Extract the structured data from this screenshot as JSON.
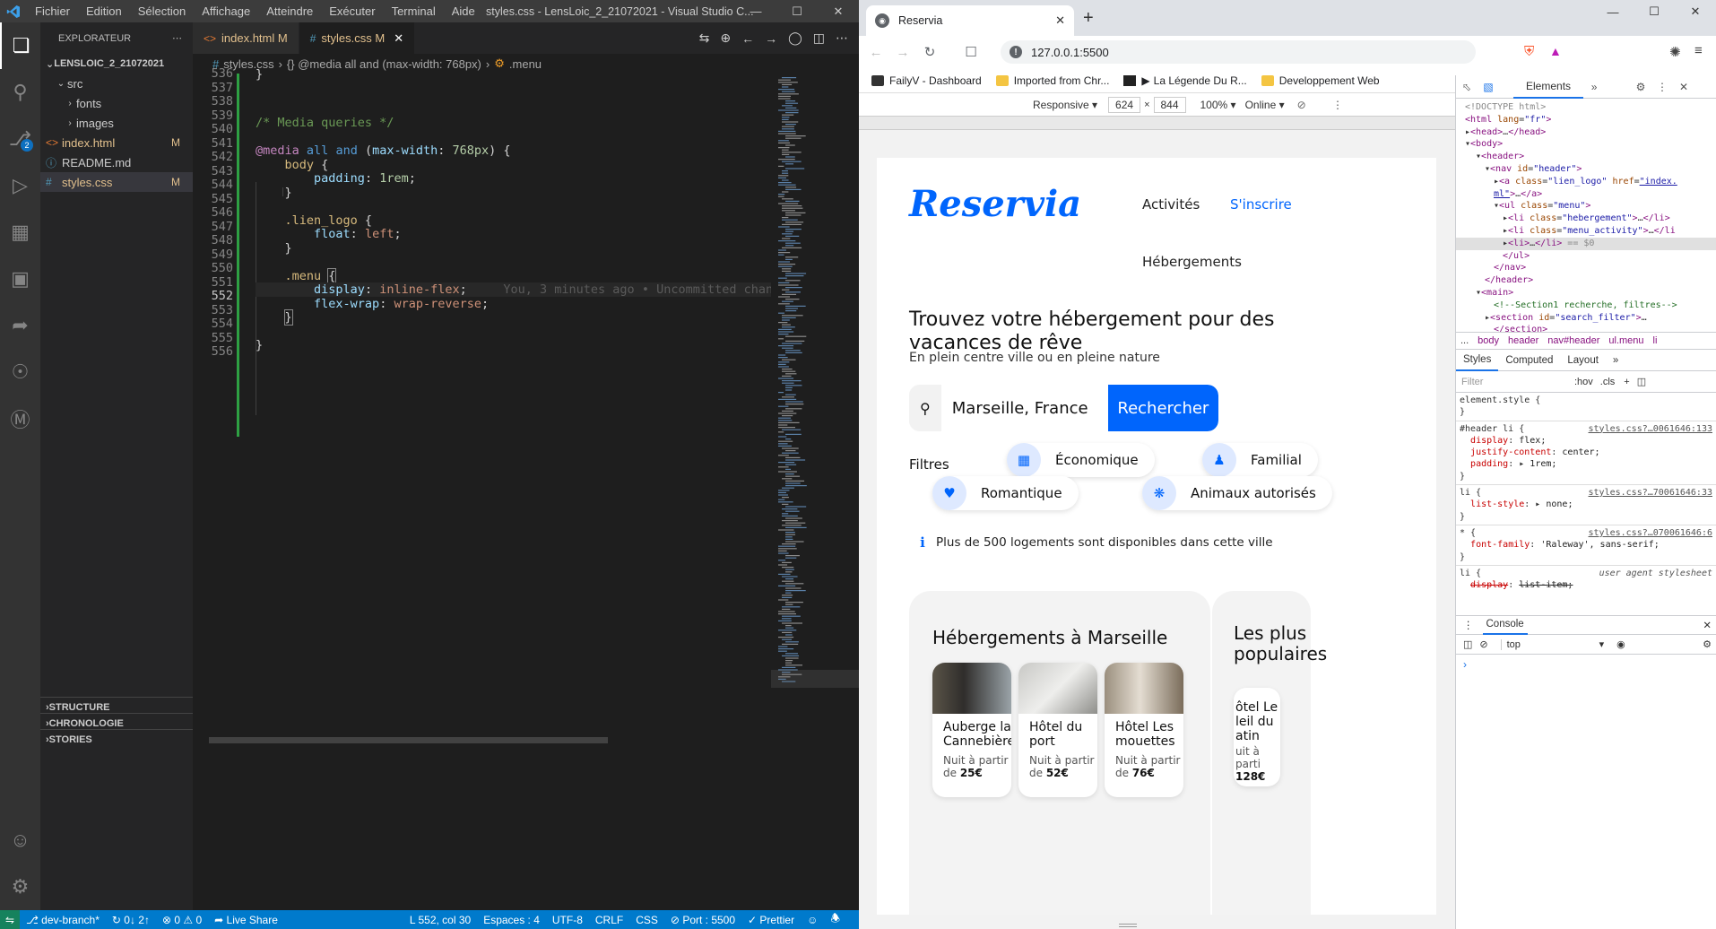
{
  "vscode": {
    "menu": [
      "Fichier",
      "Edition",
      "Sélection",
      "Affichage",
      "Atteindre",
      "Exécuter",
      "Terminal",
      "Aide"
    ],
    "window_title": "styles.css - LensLoic_2_21072021 - Visual Studio C...",
    "explorer_title": "EXPLORATEUR",
    "project": "LENSLOIC_2_21072021",
    "tree": [
      {
        "label": "src",
        "kind": "folder-open",
        "indent": 1,
        "status": ""
      },
      {
        "label": "fonts",
        "kind": "folder",
        "indent": 2,
        "status": ""
      },
      {
        "label": "images",
        "kind": "folder",
        "indent": 2,
        "status": ""
      },
      {
        "label": "index.html",
        "kind": "html",
        "indent": 1,
        "status": "M"
      },
      {
        "label": "README.md",
        "kind": "md",
        "indent": 1,
        "status": ""
      },
      {
        "label": "styles.css",
        "kind": "css",
        "indent": 1,
        "status": "M"
      }
    ],
    "panels": [
      "STRUCTURE",
      "CHRONOLOGIE",
      "STORIES"
    ],
    "tabs": [
      {
        "label": "index.html",
        "status": "M",
        "icon": "html-icon"
      },
      {
        "label": "styles.css",
        "status": "M",
        "icon": "css-icon"
      }
    ],
    "breadcrumb": [
      "styles.css",
      "{} @media all and (max-width: 768px)",
      ".menu"
    ],
    "scm_badge": "2",
    "blame": "You, 3 minutes ago • Uncommitted changes",
    "line_numbers": [
      "536",
      "537",
      "538",
      "539",
      "540",
      "541",
      "542",
      "543",
      "544",
      "545",
      "546",
      "547",
      "548",
      "549",
      "550",
      "551",
      "552",
      "553",
      "554",
      "555",
      "556"
    ],
    "status": {
      "branch": "dev-branch*",
      "sync": "0↓ 2↑",
      "problems": "0 ⚠ 0",
      "share": "Live Share",
      "position": "L 552, col 30",
      "spaces": "Espaces : 4",
      "encoding": "UTF-8",
      "eol": "CRLF",
      "lang": "CSS",
      "port": "Port : 5500",
      "prettier": "Prettier"
    }
  },
  "chrome": {
    "tab_title": "Reservia",
    "url": "127.0.0.1:5500",
    "bookmarks": [
      "FailyV - Dashboard",
      "Imported from Chr...",
      "La Légende Du R...",
      "Developpement Web"
    ],
    "device": {
      "mode": "Responsive",
      "width": "624",
      "height": "844",
      "zoom": "100%",
      "throttle": "Online"
    }
  },
  "page": {
    "logo": "Reservia",
    "menu": [
      "Activités",
      "S'inscrire",
      "Hébergements"
    ],
    "title": "Trouvez votre hébergement pour des vacances de rêve",
    "subtitle": "En plein centre ville ou en pleine nature",
    "search_value": "Marseille, France",
    "search_button": "Rechercher",
    "filters_label": "Filtres",
    "filters": [
      "Économique",
      "Familial",
      "Romantique",
      "Animaux autorisés"
    ],
    "info": "Plus de 500 logements sont disponibles dans cette ville",
    "section1_title": "Hébergements à Marseille",
    "section2_title": "Les plus populaires",
    "cards": [
      {
        "name": "Auberge la Cannebière",
        "price_label": "Nuit à partir de",
        "price": "25€"
      },
      {
        "name": "Hôtel du port",
        "price_label": "Nuit à partir de",
        "price": "52€"
      },
      {
        "name": "Hôtel Les mouettes",
        "price_label": "Nuit à partir de",
        "price": "76€"
      }
    ],
    "partial_card": {
      "name": "ôtel Le leil du atin",
      "price_label": "uit à parti",
      "price": "128€"
    }
  },
  "devtools": {
    "tab": "Elements",
    "breadcrumb": [
      "...",
      "body",
      "header",
      "nav#header",
      "ul.menu",
      "li"
    ],
    "style_tabs": [
      "Styles",
      "Computed",
      "Layout"
    ],
    "filter_placeholder": "Filter",
    "hov": ":hov",
    "cls": ".cls",
    "rules": [
      {
        "selector": "element.style {",
        "source": "",
        "props": []
      },
      {
        "selector": "#header li {",
        "source": "styles.css?…0061646:133",
        "props": [
          [
            "display",
            "flex;"
          ],
          [
            "justify-content",
            "center;"
          ],
          [
            "padding",
            "1rem;"
          ]
        ]
      },
      {
        "selector": "li {",
        "source": "styles.css?…70061646:33",
        "props": [
          [
            "list-style",
            "none;"
          ]
        ]
      },
      {
        "selector": "* {",
        "source": "styles.css?…070061646:6",
        "props": [
          [
            "font-family",
            "'Raleway', sans-serif;"
          ]
        ]
      },
      {
        "selector": "li {",
        "source": "user agent stylesheet",
        "props": [
          [
            "display",
            "list-item;"
          ]
        ]
      }
    ],
    "console_label": "Console",
    "console_context": "top"
  },
  "colors": {
    "accent": "#0065fc",
    "vscode_status": "#007acc",
    "devtools_blue": "#1a73e8"
  }
}
